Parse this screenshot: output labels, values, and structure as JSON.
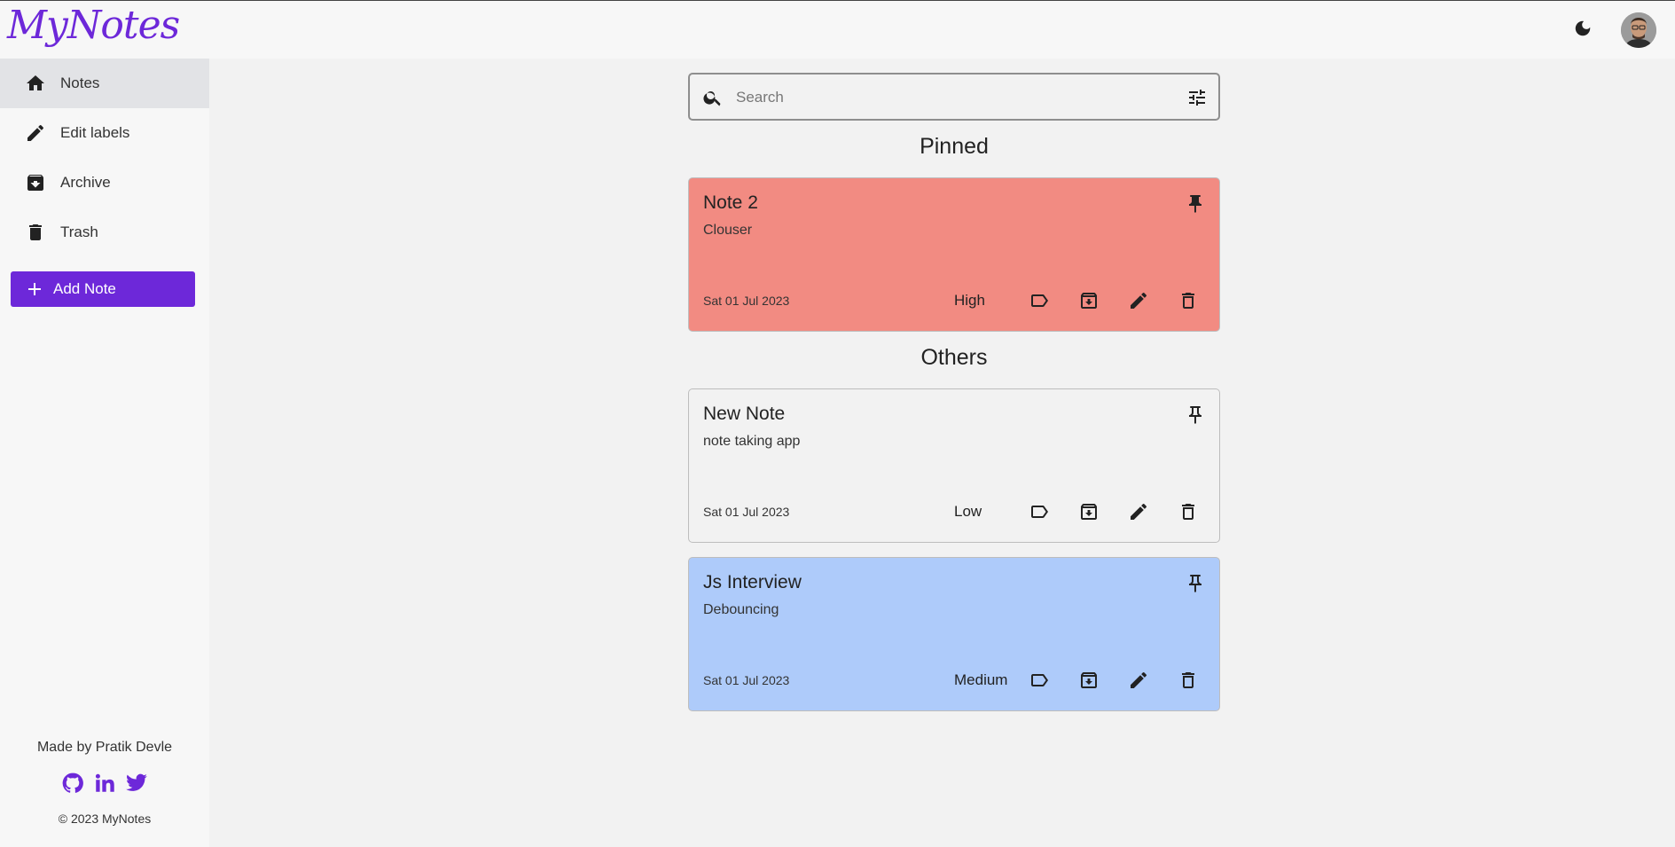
{
  "app": {
    "logo": "MyNotes"
  },
  "header": {
    "theme_icon": "moon-icon",
    "avatar_icon": "user-avatar"
  },
  "sidebar": {
    "items": [
      {
        "label": "Notes",
        "icon": "home-icon",
        "active": true
      },
      {
        "label": "Edit labels",
        "icon": "pencil-icon",
        "active": false
      },
      {
        "label": "Archive",
        "icon": "archive-icon",
        "active": false
      },
      {
        "label": "Trash",
        "icon": "trash-icon",
        "active": false
      }
    ],
    "add_note_label": "Add Note",
    "footer": {
      "made_by": "Made by Pratik Devle",
      "socials": [
        "github-icon",
        "linkedin-icon",
        "twitter-icon"
      ],
      "copyright": "© 2023 MyNotes"
    }
  },
  "search": {
    "placeholder": "Search",
    "value": ""
  },
  "sections": {
    "pinned": "Pinned",
    "others": "Others"
  },
  "notes": [
    {
      "title": "Note 2",
      "body": "Clouser",
      "date": "Sat 01 Jul 2023",
      "priority": "High",
      "color": "#f28b82",
      "pinned": true
    },
    {
      "title": "New Note",
      "body": "note taking app",
      "date": "Sat 01 Jul 2023",
      "priority": "Low",
      "color": "#f2f2f2",
      "pinned": false
    },
    {
      "title": "Js Interview",
      "body": "Debouncing",
      "date": "Sat 01 Jul 2023",
      "priority": "Medium",
      "color": "#aecbfa",
      "pinned": false
    }
  ],
  "colors": {
    "accent": "#6d28d9"
  }
}
